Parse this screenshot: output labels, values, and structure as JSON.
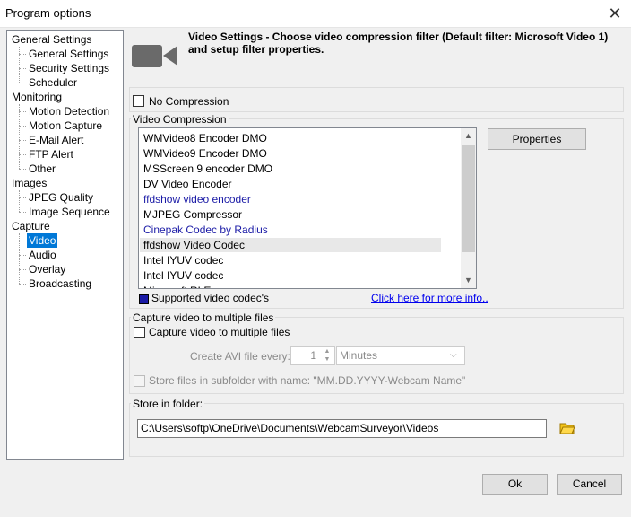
{
  "window": {
    "title": "Program options",
    "close": "✕"
  },
  "tree": [
    {
      "label": "General Settings",
      "level": 0
    },
    {
      "label": "General Settings",
      "level": 1
    },
    {
      "label": "Security Settings",
      "level": 1
    },
    {
      "label": "Scheduler",
      "level": 1
    },
    {
      "label": "Monitoring",
      "level": 0
    },
    {
      "label": "Motion Detection",
      "level": 1
    },
    {
      "label": "Motion Capture",
      "level": 1
    },
    {
      "label": "E-Mail Alert",
      "level": 1
    },
    {
      "label": "FTP Alert",
      "level": 1
    },
    {
      "label": "Other",
      "level": 1
    },
    {
      "label": "Images",
      "level": 0
    },
    {
      "label": "JPEG Quality",
      "level": 1
    },
    {
      "label": "Image Sequence",
      "level": 1
    },
    {
      "label": "Capture",
      "level": 0
    },
    {
      "label": "Video",
      "level": 1,
      "selected": true
    },
    {
      "label": "Audio",
      "level": 1
    },
    {
      "label": "Overlay",
      "level": 1
    },
    {
      "label": "Broadcasting",
      "level": 1
    }
  ],
  "header": {
    "text": "Video Settings - Choose video compression filter (Default filter: Microsoft Video 1) and setup filter properties."
  },
  "no_compression": {
    "label": "No Compression",
    "checked": false
  },
  "compression": {
    "group_label": "Video Compression",
    "codecs": [
      {
        "label": "WMVideo8 Encoder DMO",
        "supported": false
      },
      {
        "label": "WMVideo9 Encoder DMO",
        "supported": false
      },
      {
        "label": "MSScreen 9 encoder DMO",
        "supported": false
      },
      {
        "label": "DV Video Encoder",
        "supported": false
      },
      {
        "label": "ffdshow video encoder",
        "supported": true
      },
      {
        "label": "MJPEG Compressor",
        "supported": false
      },
      {
        "label": "Cinepak Codec by Radius",
        "supported": true
      },
      {
        "label": "ffdshow Video Codec",
        "supported": false,
        "highlighted": true
      },
      {
        "label": "Intel IYUV codec",
        "supported": false
      },
      {
        "label": "Intel IYUV codec",
        "supported": false
      },
      {
        "label": "Microsoft RLE",
        "supported": false
      }
    ],
    "properties_button": "Properties",
    "legend": "Supported video codec's",
    "more_info_link": "Click here for more info..",
    "legend_color": "#1a1aa6"
  },
  "multiple_files": {
    "group_label": "Capture video to multiple files",
    "checkbox_label": "Capture video to multiple files",
    "create_label": "Create AVI file every:",
    "interval_value": "1",
    "unit_value": "Minutes",
    "subfolder_label": "Store files in subfolder with name: \"MM.DD.YYYY-Webcam Name\""
  },
  "store": {
    "group_label": "Store in folder:",
    "path": "C:\\Users\\softp\\OneDrive\\Documents\\WebcamSurveyor\\Videos"
  },
  "footer": {
    "ok": "Ok",
    "cancel": "Cancel"
  },
  "colors": {
    "accent": "#0078d7",
    "folder": "#e8b600"
  }
}
